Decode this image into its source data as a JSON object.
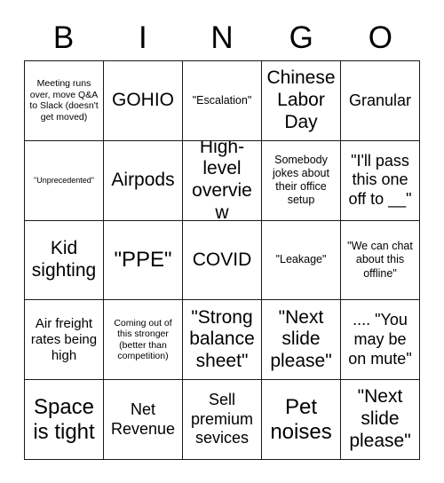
{
  "card": {
    "header_letters": [
      "B",
      "I",
      "N",
      "G",
      "O"
    ],
    "columns": 5,
    "rows": 5,
    "border_color": "#1a1a1a",
    "background_color": "#ffffff",
    "text_color": "#000000",
    "cells": [
      [
        {
          "text": "Meeting runs over, move Q&A to Slack (doesn't get moved)",
          "size": "sm"
        },
        {
          "text": "GOHIO",
          "size": "2xl"
        },
        {
          "text": "\"Escalation\"",
          "size": "md"
        },
        {
          "text": "Chinese Labor Day",
          "size": "2xl"
        },
        {
          "text": "Granular",
          "size": "xl"
        }
      ],
      [
        {
          "text": "\"Unprecedented\"",
          "size": "xs"
        },
        {
          "text": "Airpods",
          "size": "2xl"
        },
        {
          "text": "High-level overview",
          "size": "2xl"
        },
        {
          "text": "Somebody jokes about their office setup",
          "size": "md"
        },
        {
          "text": "\"I'll pass this one off to __\"",
          "size": "xl"
        }
      ],
      [
        {
          "text": "Kid sighting",
          "size": "2xl"
        },
        {
          "text": "\"PPE\"",
          "size": "3xl"
        },
        {
          "text": "COVID",
          "size": "2xl"
        },
        {
          "text": "\"Leakage\"",
          "size": "md"
        },
        {
          "text": "\"We can chat about this offline\"",
          "size": "md"
        }
      ],
      [
        {
          "text": "Air freight rates being high",
          "size": "lg"
        },
        {
          "text": "Coming out of this stronger (better than competition)",
          "size": "sm"
        },
        {
          "text": "\"Strong balance sheet\"",
          "size": "2xl"
        },
        {
          "text": "\"Next slide please\"",
          "size": "2xl"
        },
        {
          "text": ".... \"You may be on mute\"",
          "size": "xl"
        }
      ],
      [
        {
          "text": "Space is tight",
          "size": "3xl"
        },
        {
          "text": "Net Revenue",
          "size": "xl"
        },
        {
          "text": "Sell premium sevices",
          "size": "xl"
        },
        {
          "text": "Pet noises",
          "size": "3xl"
        },
        {
          "text": "\"Next slide please\"",
          "size": "2xl"
        }
      ]
    ]
  }
}
